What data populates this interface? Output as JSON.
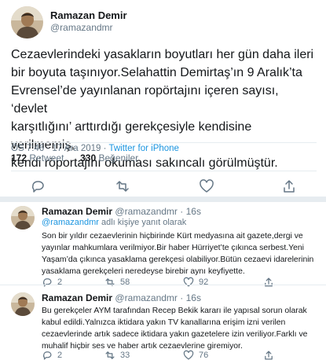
{
  "tweet": {
    "name": "Ramazan Demir",
    "handle": "@ramazandmr",
    "text": "Cezaevlerindeki yasakların boyutları her gün daha ileri\nbir boyuta taşınıyor.Selahattin Demirtaş’ın 9 Aralık’ta\nEvrensel’de yayınlanan ropörtajını içeren sayısı, ‘devlet\nkarşıtlığını’ arttırdığı gerekçesiyle kendisine verilmemiş,\nkendi röportajını okuması sakıncalı görülmüştür.",
    "time": "ÖS 7:46 · 17 Ara 2019 ·",
    "source": "Twitter for iPhone",
    "retweets": "172",
    "retweets_label": "Retweet",
    "likes": "330",
    "likes_label": "Beğeniler"
  },
  "replies": [
    {
      "name": "Ramazan Demir",
      "handle": "@ramazandmr",
      "age": "· 16s",
      "reply_to_handle": "@ramazandmr",
      "reply_to_text": "adlı kişiye yanıt olarak",
      "text": "Son bir yıldır cezaevlerinin hiçbirinde Kürt medyasına ait gazete,dergi ve\nyayınlar mahkumlara verilmiyor.Bir haber Hürriyet’te çıkınca serbest.Yeni\nYaşam’da çıkınca yasaklama gerekçesi olabiliyor.Bütün cezaevi idarelerinin\nyasaklama gerekçeleri neredeyse birebir aynı keyfiyette.",
      "reply_count": "2",
      "retweet_count": "58",
      "like_count": "92"
    },
    {
      "name": "Ramazan Demir",
      "handle": "@ramazandmr",
      "age": "· 16s",
      "text": "Bu gerekçeler AYM tarafından Recep Bekik kararı ile yapısal sorun olarak\nkabul edildi.Yalnızca iktidara yakın TV kanallarına erişim izni verilen\ncezaevlerinde artık sadece iktidara yakın gazetelere izin veriliyor.Farklı ve\nmuhalif hiçbir ses ve haber artık cezaevlerine giremiyor.",
      "reply_count": "2",
      "retweet_count": "33",
      "like_count": "76"
    }
  ],
  "colors": {
    "accent": "#1b95e0",
    "muted": "#657786",
    "divider": "#e6ecf0",
    "text": "#14171a"
  }
}
